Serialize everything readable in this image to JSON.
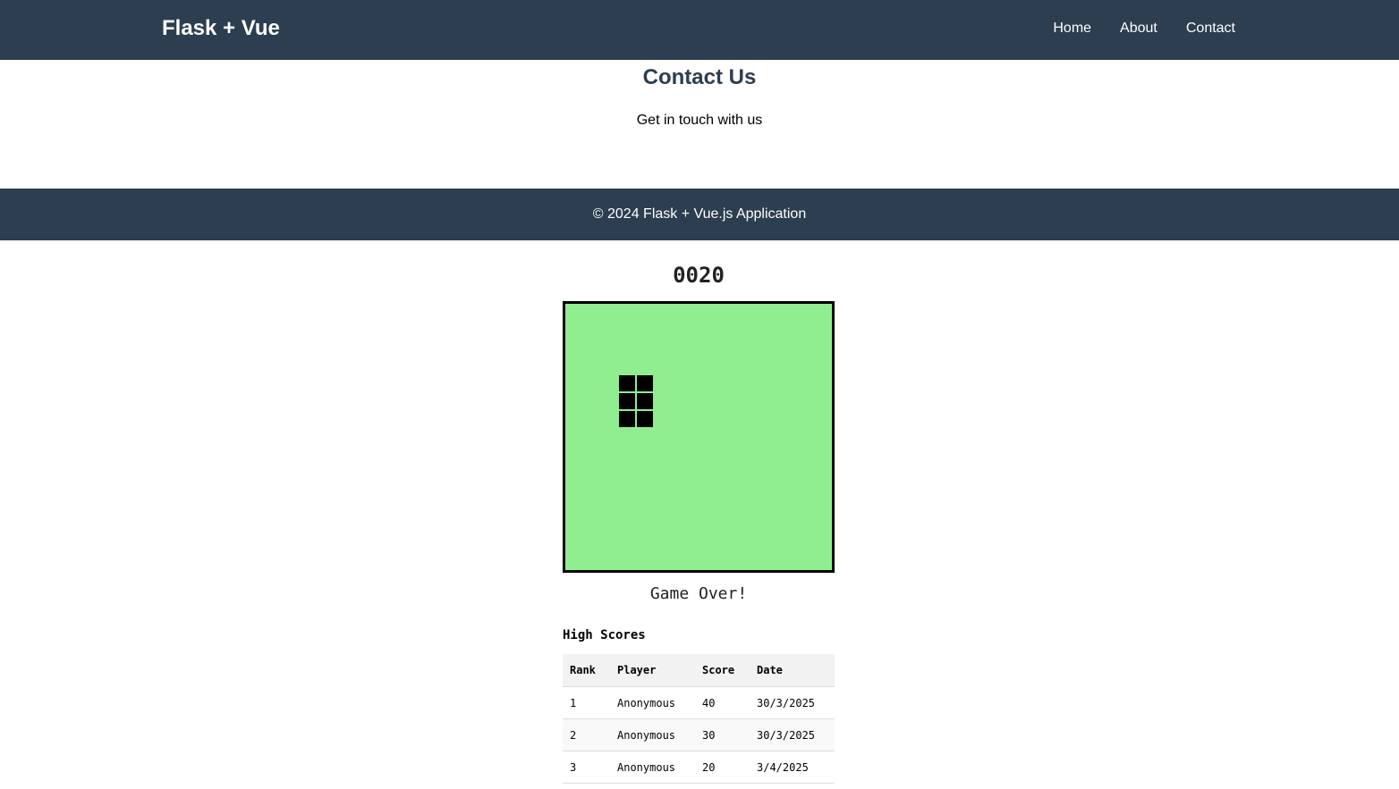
{
  "navbar": {
    "brand": "Flask + Vue",
    "links": [
      {
        "label": "Home"
      },
      {
        "label": "About"
      },
      {
        "label": "Contact"
      }
    ]
  },
  "contact": {
    "title": "Contact Us",
    "subtitle": "Get in touch with us"
  },
  "footer": {
    "text": "© 2024 Flask + Vue.js Application"
  },
  "game": {
    "score": "0020",
    "status": "Game Over!",
    "board_color": "#90ee90",
    "snake_color": "#000000",
    "grid_size": 15,
    "snake_cells": [
      [
        3,
        4
      ],
      [
        4,
        4
      ],
      [
        3,
        5
      ],
      [
        4,
        5
      ],
      [
        3,
        6
      ],
      [
        4,
        6
      ]
    ]
  },
  "high_scores": {
    "title": "High Scores",
    "columns": [
      "Rank",
      "Player",
      "Score",
      "Date"
    ],
    "rows": [
      {
        "rank": "1",
        "player": "Anonymous",
        "score": "40",
        "date": "30/3/2025"
      },
      {
        "rank": "2",
        "player": "Anonymous",
        "score": "30",
        "date": "30/3/2025"
      },
      {
        "rank": "3",
        "player": "Anonymous",
        "score": "20",
        "date": "3/4/2025"
      }
    ]
  },
  "colors": {
    "header_bg": "#2c3e50",
    "title_color": "#2c3e50"
  }
}
